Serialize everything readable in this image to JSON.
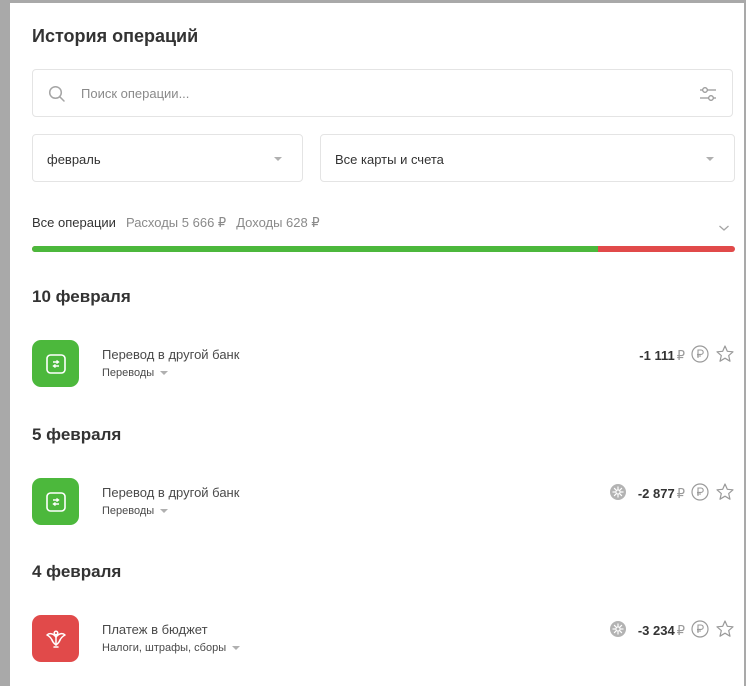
{
  "header": {
    "title": "История операций"
  },
  "search": {
    "placeholder": "Поиск операции..."
  },
  "filters": {
    "period": "февраль",
    "accounts": "Все карты и счета"
  },
  "summary": {
    "all_label": "Все операции",
    "expenses": "Расходы 5 666 ₽",
    "income": "Доходы 628 ₽",
    "expenses_share": 0.805
  },
  "colors": {
    "transfer": "#4cb83c",
    "budget": "#e14a4a",
    "bar_green": "#4cb83c",
    "bar_red": "#e14a4a"
  },
  "groups": [
    {
      "date": "10 февраля",
      "operations": [
        {
          "name": "Перевод в другой банк",
          "category": "Переводы",
          "amount": "-1 111",
          "currency": "₽",
          "icon": "transfer-icon",
          "cashback": false
        }
      ]
    },
    {
      "date": "5 февраля",
      "operations": [
        {
          "name": "Перевод в другой банк",
          "category": "Переводы",
          "amount": "-2 877",
          "currency": "₽",
          "icon": "transfer-icon",
          "cashback": true
        }
      ]
    },
    {
      "date": "4 февраля",
      "operations": [
        {
          "name": "Платеж в бюджет",
          "category": "Налоги, штрафы, сборы",
          "amount": "-3 234",
          "currency": "₽",
          "icon": "budget-emblem-icon",
          "cashback": true
        }
      ]
    }
  ]
}
